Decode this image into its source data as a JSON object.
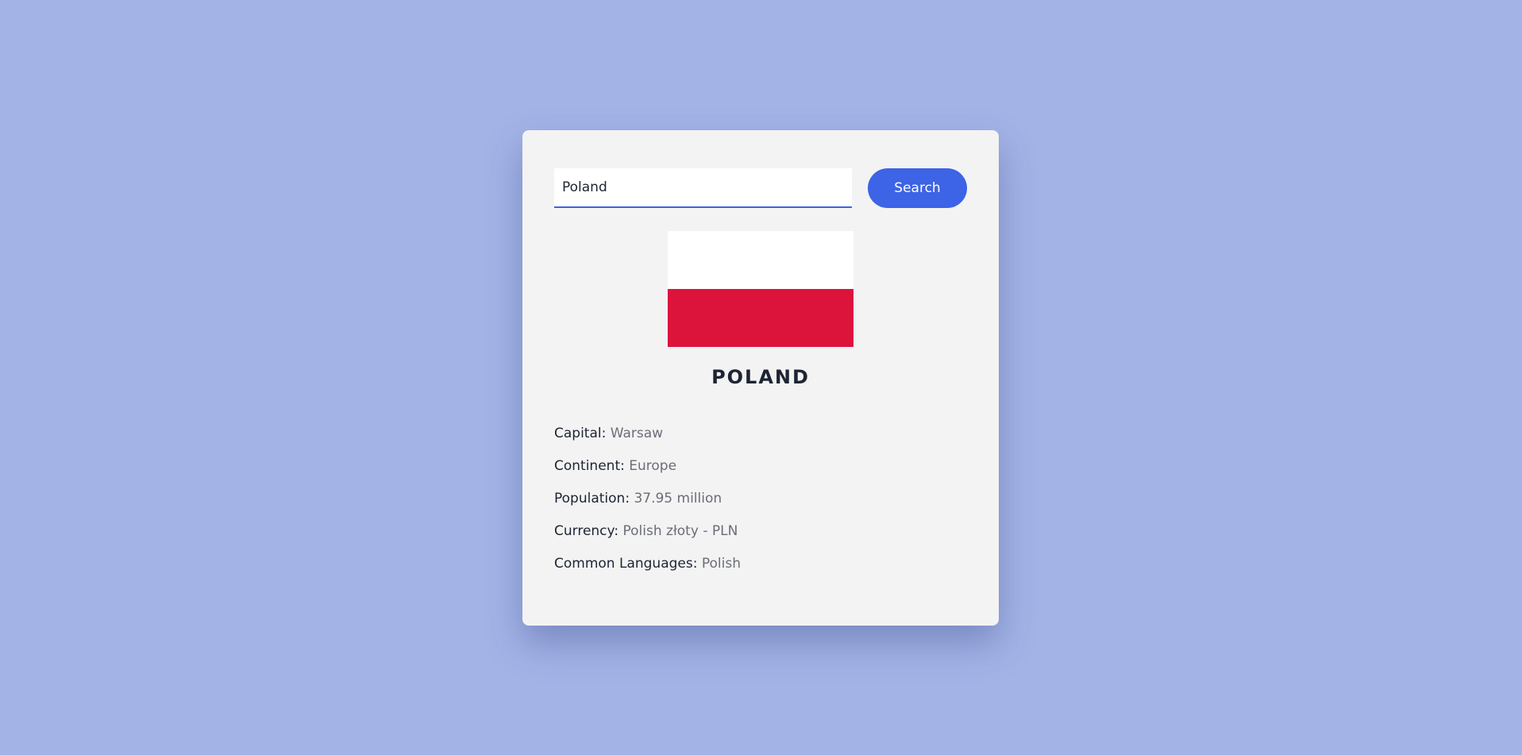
{
  "search": {
    "value": "Poland",
    "button_label": "Search"
  },
  "colors": {
    "background": "#a3b3e6",
    "card": "#f3f3f3",
    "accent": "#3d63e6",
    "flag_top": "#ffffff",
    "flag_bottom": "#dc143c"
  },
  "country": {
    "name": "POLAND",
    "details": [
      {
        "label": "Capital:",
        "value": "Warsaw"
      },
      {
        "label": "Continent:",
        "value": "Europe"
      },
      {
        "label": "Population:",
        "value": "37.95 million"
      },
      {
        "label": "Currency:",
        "value": "Polish złoty - PLN"
      },
      {
        "label": "Common Languages:",
        "value": "Polish"
      }
    ]
  }
}
